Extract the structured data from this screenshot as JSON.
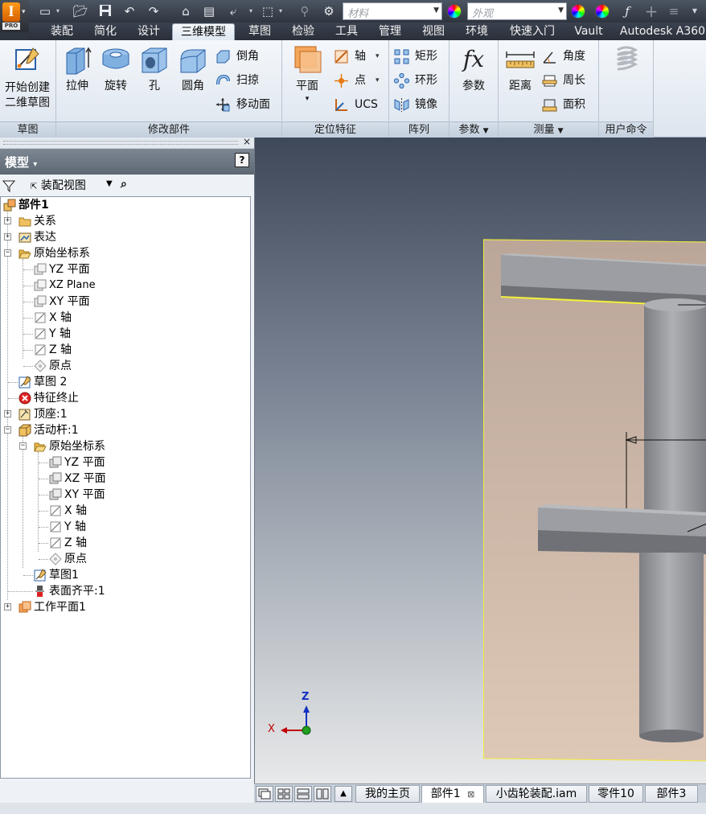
{
  "app": {
    "logo_letter": "I",
    "edition_badge": "PRO"
  },
  "quick_access": {
    "material_placeholder": "材料",
    "appearance_placeholder": "外观",
    "icons": [
      "new-icon",
      "open-icon",
      "save-icon",
      "undo-icon",
      "redo-icon",
      "home-icon",
      "project-icon",
      "return-icon",
      "select-icon",
      "measure-icon",
      "update-icon",
      "material-ball-icon",
      "clear-appearance-icon",
      "fx-icon",
      "plus-icon",
      "more-icon"
    ]
  },
  "ribbon_tabs": [
    {
      "label": "装配",
      "active": false
    },
    {
      "label": "简化",
      "active": false
    },
    {
      "label": "设计",
      "active": false
    },
    {
      "label": "三维模型",
      "active": true
    },
    {
      "label": "草图",
      "active": false
    },
    {
      "label": "检验",
      "active": false
    },
    {
      "label": "工具",
      "active": false
    },
    {
      "label": "管理",
      "active": false
    },
    {
      "label": "视图",
      "active": false
    },
    {
      "label": "环境",
      "active": false
    },
    {
      "label": "快速入门",
      "active": false
    },
    {
      "label": "Vault",
      "active": false
    },
    {
      "label": "Autodesk A360",
      "active": false
    }
  ],
  "ribbon": {
    "sketch_panel": {
      "title": "草图",
      "start_sketch_line1": "开始创建",
      "start_sketch_line2": "二维草图"
    },
    "modify_panel": {
      "title": "修改部件",
      "extrude": "拉伸",
      "revolve": "旋转",
      "hole": "孔",
      "fillet": "圆角",
      "chamfer": "倒角",
      "sweep": "扫掠",
      "move_face": "移动面"
    },
    "work_features_panel": {
      "title": "定位特征",
      "plane": "平面",
      "axis": "轴",
      "point": "点",
      "ucs": "UCS"
    },
    "pattern_panel": {
      "title": "阵列",
      "rectangular": "矩形",
      "circular": "环形",
      "mirror": "镜像"
    },
    "parameters_panel": {
      "title": "参数",
      "parameters": "参数",
      "fx_symbol": "fx"
    },
    "measure_panel": {
      "title": "测量",
      "distance": "距离",
      "angle": "角度",
      "loop": "周长",
      "area": "面积"
    },
    "user_commands_panel": {
      "title": "用户命令"
    }
  },
  "browser": {
    "header_title": "模型",
    "help_label": "?",
    "view_label": "装配视图",
    "tree": [
      {
        "label": "部件1",
        "icon": "assembly-icon",
        "bold": true
      },
      {
        "label": "关系",
        "icon": "folder-icon"
      },
      {
        "label": "表达",
        "icon": "representations-icon"
      },
      {
        "label": "原始坐标系",
        "icon": "folder-open-icon"
      },
      {
        "label": "YZ 平面",
        "icon": "plane-icon"
      },
      {
        "label": "XZ Plane",
        "icon": "plane-icon"
      },
      {
        "label": "XY 平面",
        "icon": "plane-icon"
      },
      {
        "label": "X 轴",
        "icon": "axis-icon"
      },
      {
        "label": "Y 轴",
        "icon": "axis-icon"
      },
      {
        "label": "Z 轴",
        "icon": "axis-icon"
      },
      {
        "label": "原点",
        "icon": "origin-point-icon"
      },
      {
        "label": "草图 2",
        "icon": "sketch-icon"
      },
      {
        "label": "特征终止",
        "icon": "end-of-features-icon"
      },
      {
        "label": "顶座:1",
        "icon": "component-icon"
      },
      {
        "label": "活动杆:1",
        "icon": "part-icon"
      },
      {
        "label": "原始坐标系",
        "icon": "folder-open-icon"
      },
      {
        "label": "YZ 平面",
        "icon": "plane-icon"
      },
      {
        "label": "XZ 平面",
        "icon": "plane-icon"
      },
      {
        "label": "XY 平面",
        "icon": "plane-icon"
      },
      {
        "label": "X 轴",
        "icon": "axis-icon"
      },
      {
        "label": "Y 轴",
        "icon": "axis-icon"
      },
      {
        "label": "Z 轴",
        "icon": "axis-icon"
      },
      {
        "label": "原点",
        "icon": "origin-point-icon"
      },
      {
        "label": "草图1",
        "icon": "sketch-icon"
      },
      {
        "label": "表面齐平:1",
        "icon": "flush-constraint-icon"
      },
      {
        "label": "工作平面1",
        "icon": "work-plane-icon"
      }
    ]
  },
  "viewport": {
    "triad": {
      "x_label": "X",
      "z_label": "Z"
    }
  },
  "document_tabs": [
    {
      "label": "我的主页",
      "active": false
    },
    {
      "label": "部件1",
      "active": true
    },
    {
      "label": "小齿轮装配.iam",
      "active": false
    },
    {
      "label": "零件10",
      "active": false
    },
    {
      "label": "部件3",
      "active": false
    }
  ],
  "colors": {
    "accent_orange": "#e87a12",
    "tab_bar": "#2f353f",
    "work_plane_edge": "#f2ee3a",
    "part_gray": "#9c9ea3"
  }
}
